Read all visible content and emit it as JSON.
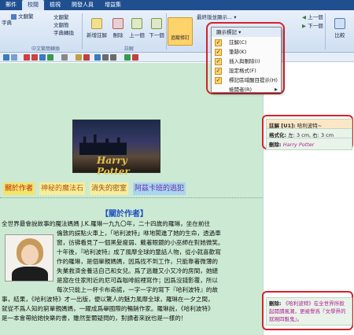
{
  "tabs": [
    "郵件",
    "校閱",
    "檢視",
    "開發人員",
    "增益集"
  ],
  "ribbon": {
    "left_items": [
      "字典",
      "文翻繁",
      "文翻簡",
      "字典轉換",
      "中文繁簡轉換"
    ],
    "new_comment": "新增註解",
    "delete": "刪除",
    "prev": "上一個",
    "next": "下一個",
    "comments_group": "註解",
    "track_changes": "追蹤修訂",
    "compare": "比較",
    "prev_right": "上一個",
    "next_right": "下一個",
    "dropdown_label": "最終版並顯示...",
    "show_markup": "顯示標記"
  },
  "menu": {
    "items": [
      {
        "label": "註解(C)",
        "checked": true
      },
      {
        "label": "筆跡(K)",
        "checked": true
      },
      {
        "label": "插入與刪除(I)",
        "checked": true
      },
      {
        "label": "設定格式(F)",
        "checked": true
      },
      {
        "label": "標記區域醒目提示(H)",
        "checked": true
      },
      {
        "label": "檢閱者(R)",
        "checked": false,
        "submenu": true
      }
    ]
  },
  "doc": {
    "image_logo": "Harry Potter",
    "nav": [
      "關於作者",
      "神秘的魔法石",
      "消失的密室",
      "阿茲卡班的逃犯"
    ],
    "heading": "【關於作者】",
    "lines": [
      "全世界最會說故事的魔法媽媽 J.K.羅琳一九九〇年，二十四歲的羅琳，坐在前往",
      "倫敦的誤點火車上，「哈利波特」咻地闖進了她的生命，透過車",
      "窗，彷彿看見了一個黑髮瘦弱、戴著眼鏡的小巫師在對她微笑。",
      "十年後，『哈利波特』成了風靡全球的童話人物，從小就喜歡寫",
      "作的羅琳，是個單親媽媽，因爲找不到工作，只能靠著微薄的",
      "失業救濟金養活自己和女兒。爲了逃離又小又冷的房間，她總",
      "是窩在住家附近的尼可森咖啡館裡寫作；因爲沒錢影覆，所以",
      "每次只能上一杯卡布奇諾，一字一字的寫下『哈利波特』的故",
      "事，結果，《哈利波特》才一出版，便以驚人的魅力風靡全球，羅琳在一夕之間，",
      "就從不爲人知的窮單親媽媽，一躍成爲舉國際的暢銷作家。羅琳說，《哈利波特》",
      "是一本會帶給她快樂的書，雖然奎爾疑問的，對讀者來說也是一樣的！"
    ]
  },
  "comments": {
    "c1_label": "註解 [U1]:",
    "c1_text": "哈利波特~",
    "c2_label": "格式化:",
    "c2_text": "左: 3 cm, 右: 3 cm",
    "c3_label": "刪除:",
    "c3_text": "Harry Potter",
    "c4_label": "刪除:",
    "c4_text": "《哈利波特》在全世界所掀起閱讀風潮，更被譽爲『文學界的就現四魁鬼』。"
  }
}
